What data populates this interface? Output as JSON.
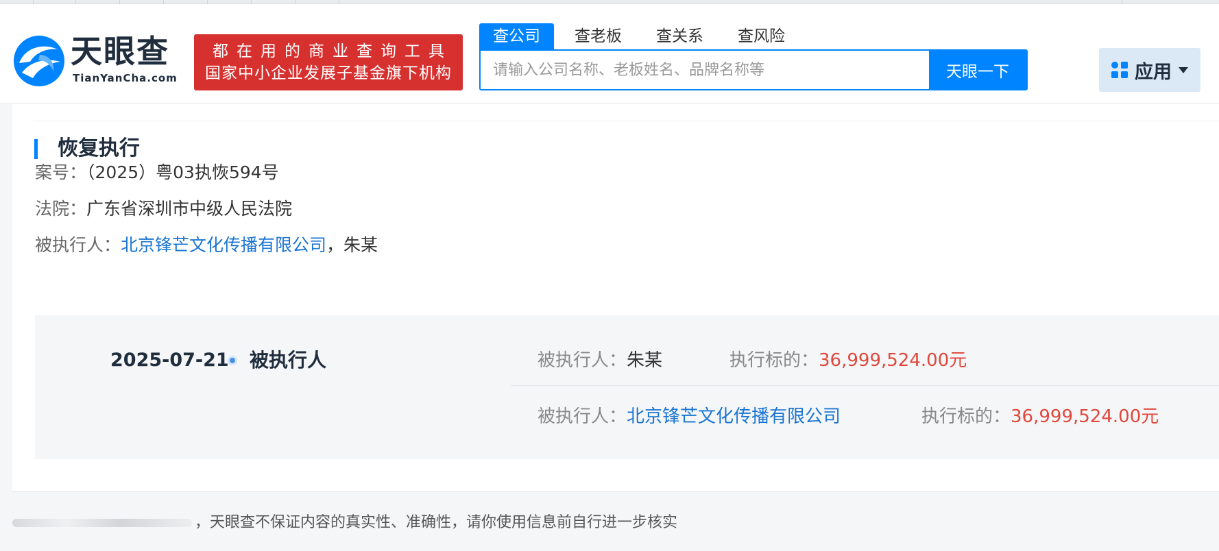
{
  "brand": {
    "name": "天眼查",
    "domain": "TianYanCha.com",
    "slogan_line1": "都在用的商业查询工具",
    "slogan_line2": "国家中小企业发展子基金旗下机构",
    "color": "#0084ff"
  },
  "search": {
    "tabs": [
      {
        "label": "查公司",
        "active": true
      },
      {
        "label": "查老板",
        "active": false
      },
      {
        "label": "查关系",
        "active": false
      },
      {
        "label": "查风险",
        "active": false
      }
    ],
    "placeholder": "请输入公司名称、老板姓名、品牌名称等",
    "button_label": "天眼一下"
  },
  "apps_button": {
    "label": "应用",
    "icon": "apps-grid-icon"
  },
  "section": {
    "title": "恢复执行",
    "case_no_label": "案号：",
    "case_no": "（2025）粤03执恢594号",
    "court_label": "法院：",
    "court": "广东省深圳市中级人民法院",
    "executed_label": "被执行人：",
    "executed_company": "北京锋芒文化传播有限公司",
    "executed_sep": "，",
    "executed_person": "朱某"
  },
  "detail": {
    "date": "2025-07-21",
    "role": "被执行人",
    "rows": [
      {
        "name_label": "被执行人：",
        "name": "朱某",
        "amount_label": "执行标的：",
        "amount": "36,999,524.00元"
      },
      {
        "name_label": "被执行人：",
        "name": "北京锋芒文化传播有限公司",
        "amount_label": "执行标的：",
        "amount": "36,999,524.00元"
      }
    ],
    "money_color": "#e0473b",
    "link_color": "#1a75d2"
  },
  "footer": {
    "disclaimer": "，天眼查不保证内容的真实性、准确性，请你使用信息前自行进一步核实"
  }
}
